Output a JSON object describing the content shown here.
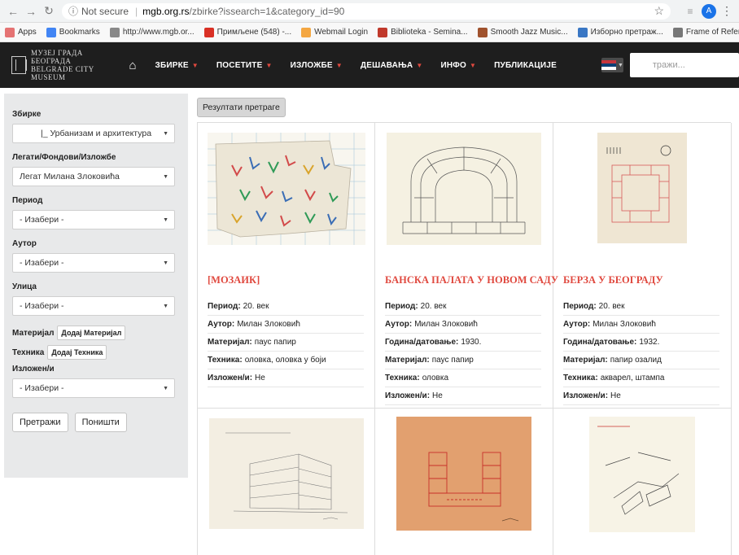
{
  "browser": {
    "url_security": "Not secure",
    "url_host": "mgb.org.rs",
    "url_path": "/zbirke?issearch=1&category_id=90",
    "avatar_letter": "A",
    "bookmarks": [
      {
        "label": "Apps",
        "color": "#e57373"
      },
      {
        "label": "Bookmarks",
        "color": "#4285f4"
      },
      {
        "label": "http://www.mgb.or...",
        "color": "#888888"
      },
      {
        "label": "Примљене (548) -...",
        "color": "#d93025"
      },
      {
        "label": "Webmail Login",
        "color": "#f4a742"
      },
      {
        "label": "Biblioteka - Semina...",
        "color": "#c0392b"
      },
      {
        "label": "Smooth Jazz Music...",
        "color": "#a0522d"
      },
      {
        "label": "Изборно претраж...",
        "color": "#3a77c4"
      },
      {
        "label": "Frame of Reference...",
        "color": "#777777"
      }
    ],
    "bookmarks_more": "»"
  },
  "site": {
    "logo_line1": "МУЗЕЈ ГРАДА БЕОГРАДА",
    "logo_line2": "BELGRADE CITY MUSEUM",
    "menu": [
      {
        "label": "ЗБИРКЕ",
        "has_caret": true
      },
      {
        "label": "ПОСЕТИТЕ",
        "has_caret": true
      },
      {
        "label": "ИЗЛОЖБЕ",
        "has_caret": true
      },
      {
        "label": "ДЕШАВАЊА",
        "has_caret": true
      },
      {
        "label": "ИНФО",
        "has_caret": true
      },
      {
        "label": "ПУБЛИКАЦИЈЕ",
        "has_caret": false
      }
    ],
    "search_placeholder": "тражи...",
    "accent_color": "#e0493f"
  },
  "filters": {
    "zbirke_label": "Збирке",
    "zbirke_value": "|_ Урбанизам и архитектура",
    "legati_label": "Легати/Фондови/Изложбе",
    "legati_value": "Легат Милана Злоковића",
    "period_label": "Период",
    "period_value": "- Изабери -",
    "autor_label": "Аутор",
    "autor_value": "- Изабери -",
    "ulica_label": "Улица",
    "ulica_value": "- Изабери -",
    "materijal_label": "Материјал",
    "materijal_btn": "Додај Материјал",
    "tehnika_label": "Техника",
    "tehnika_btn": "Додај Техника",
    "izlozen_label": "Изложен/и",
    "izlozen_value": "- Изабери -",
    "search_btn": "Претражи",
    "reset_btn": "Поништи"
  },
  "results": {
    "header_btn": "Резултати претраге",
    "cards": [
      {
        "title": "[МОЗАИК]",
        "meta": [
          {
            "k": "Период:",
            "v": "20. век"
          },
          {
            "k": "Аутор:",
            "v": "Милан Злоковић"
          },
          {
            "k": "Материјал:",
            "v": "паус папир"
          },
          {
            "k": "Техника:",
            "v": "оловка, оловка у боји"
          },
          {
            "k": "Изложен/и:",
            "v": "Не"
          }
        ]
      },
      {
        "title": "БАНСКА ПАЛАТА У НОВОМ САДУ",
        "meta": [
          {
            "k": "Период:",
            "v": "20. век"
          },
          {
            "k": "Аутор:",
            "v": "Милан Злоковић"
          },
          {
            "k": "Година/датовање:",
            "v": "1930."
          },
          {
            "k": "Материјал:",
            "v": "паус папир"
          },
          {
            "k": "Техника:",
            "v": "оловка"
          },
          {
            "k": "Изложен/и:",
            "v": "Не"
          }
        ]
      },
      {
        "title": "БЕРЗА У БЕОГРАДУ",
        "meta": [
          {
            "k": "Период:",
            "v": "20. век"
          },
          {
            "k": "Аутор:",
            "v": "Милан Злоковић"
          },
          {
            "k": "Година/датовање:",
            "v": "1932."
          },
          {
            "k": "Материјал:",
            "v": "папир озалид"
          },
          {
            "k": "Техника:",
            "v": "акварел, штампа"
          },
          {
            "k": "Изложен/и:",
            "v": "Не"
          }
        ]
      }
    ]
  }
}
